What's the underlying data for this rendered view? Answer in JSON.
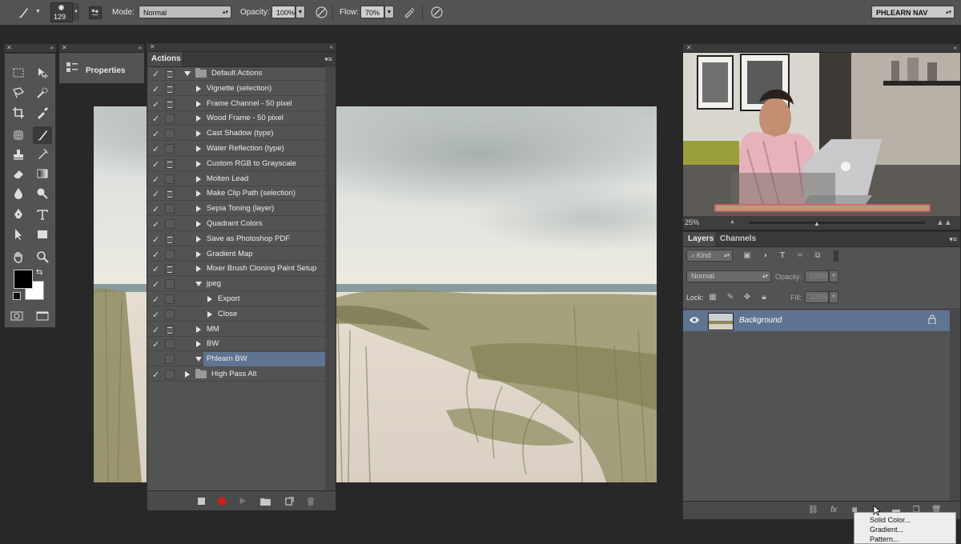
{
  "options_bar": {
    "brush_size": "129",
    "mode_label": "Mode:",
    "mode_value": "Normal",
    "opacity_label": "Opacity:",
    "opacity_value": "100%",
    "flow_label": "Flow:",
    "flow_value": "70%",
    "workspace_value": "PHLEARN NAV"
  },
  "properties": {
    "label": "Properties"
  },
  "actions": {
    "tab_label": "Actions",
    "rows": [
      {
        "check": "✓",
        "dialog": true,
        "indent": 0,
        "kind": "set",
        "open": true,
        "label": "Default Actions"
      },
      {
        "check": "✓",
        "dialog": true,
        "indent": 1,
        "kind": "action",
        "open": false,
        "label": "Vignette (selection)"
      },
      {
        "check": "✓",
        "dialog": true,
        "indent": 1,
        "kind": "action",
        "open": false,
        "label": "Frame Channel - 50 pixel"
      },
      {
        "check": "✓",
        "dialog": false,
        "indent": 1,
        "kind": "action",
        "open": false,
        "label": "Wood Frame - 50 pixel"
      },
      {
        "check": "✓",
        "dialog": false,
        "indent": 1,
        "kind": "action",
        "open": false,
        "label": "Cast Shadow (type)"
      },
      {
        "check": "✓",
        "dialog": false,
        "indent": 1,
        "kind": "action",
        "open": false,
        "label": "Water Reflection (type)"
      },
      {
        "check": "✓",
        "dialog": true,
        "indent": 1,
        "kind": "action",
        "open": false,
        "label": "Custom RGB to Grayscale"
      },
      {
        "check": "✓",
        "dialog": false,
        "indent": 1,
        "kind": "action",
        "open": false,
        "label": "Molten Lead"
      },
      {
        "check": "✓",
        "dialog": true,
        "indent": 1,
        "kind": "action",
        "open": false,
        "label": "Make Clip Path (selection)"
      },
      {
        "check": "✓",
        "dialog": false,
        "indent": 1,
        "kind": "action",
        "open": false,
        "label": "Sepia Toning (layer)"
      },
      {
        "check": "✓",
        "dialog": false,
        "indent": 1,
        "kind": "action",
        "open": false,
        "label": "Quadrant Colors"
      },
      {
        "check": "✓",
        "dialog": true,
        "indent": 1,
        "kind": "action",
        "open": false,
        "label": "Save as Photoshop PDF"
      },
      {
        "check": "✓",
        "dialog": false,
        "indent": 1,
        "kind": "action",
        "open": false,
        "label": "Gradient Map"
      },
      {
        "check": "✓",
        "dialog": true,
        "indent": 1,
        "kind": "action",
        "open": false,
        "label": "Mixer Brush Cloning Paint Setup"
      },
      {
        "check": "✓",
        "dialog": false,
        "indent": 1,
        "kind": "action",
        "open": true,
        "label": "jpeg"
      },
      {
        "check": "✓",
        "dialog": false,
        "indent": 2,
        "kind": "step",
        "open": false,
        "label": "Export"
      },
      {
        "check": "✓",
        "dialog": false,
        "indent": 2,
        "kind": "step",
        "open": false,
        "label": "Close"
      },
      {
        "check": "✓",
        "dialog": true,
        "indent": 1,
        "kind": "action",
        "open": false,
        "label": "MM"
      },
      {
        "check": "✓",
        "dialog": false,
        "indent": 1,
        "kind": "action",
        "open": false,
        "label": "BW"
      },
      {
        "check": "",
        "dialog": false,
        "indent": 1,
        "kind": "action",
        "open": true,
        "label": "Phlearn BW",
        "selected": true
      },
      {
        "check": "✓",
        "dialog": false,
        "indent": 0,
        "kind": "set",
        "open": false,
        "label": "High Pass Alt"
      }
    ]
  },
  "video": {
    "zoom": "25%"
  },
  "layers": {
    "tabs": [
      "Layers",
      "Channels"
    ],
    "filter_value": "Kind",
    "blend_value": "Normal",
    "opacity_label": "Opacity:",
    "opacity_value": "100%",
    "lock_label": "Lock:",
    "fill_label": "Fill:",
    "fill_value": "100%",
    "layer_name": "Background"
  },
  "context_menu": {
    "items": [
      "Solid Color...",
      "Gradient...",
      "Pattern..."
    ]
  },
  "colors": {
    "selection": "#5f7392",
    "panel": "#535353",
    "record": "#d81a1a"
  }
}
